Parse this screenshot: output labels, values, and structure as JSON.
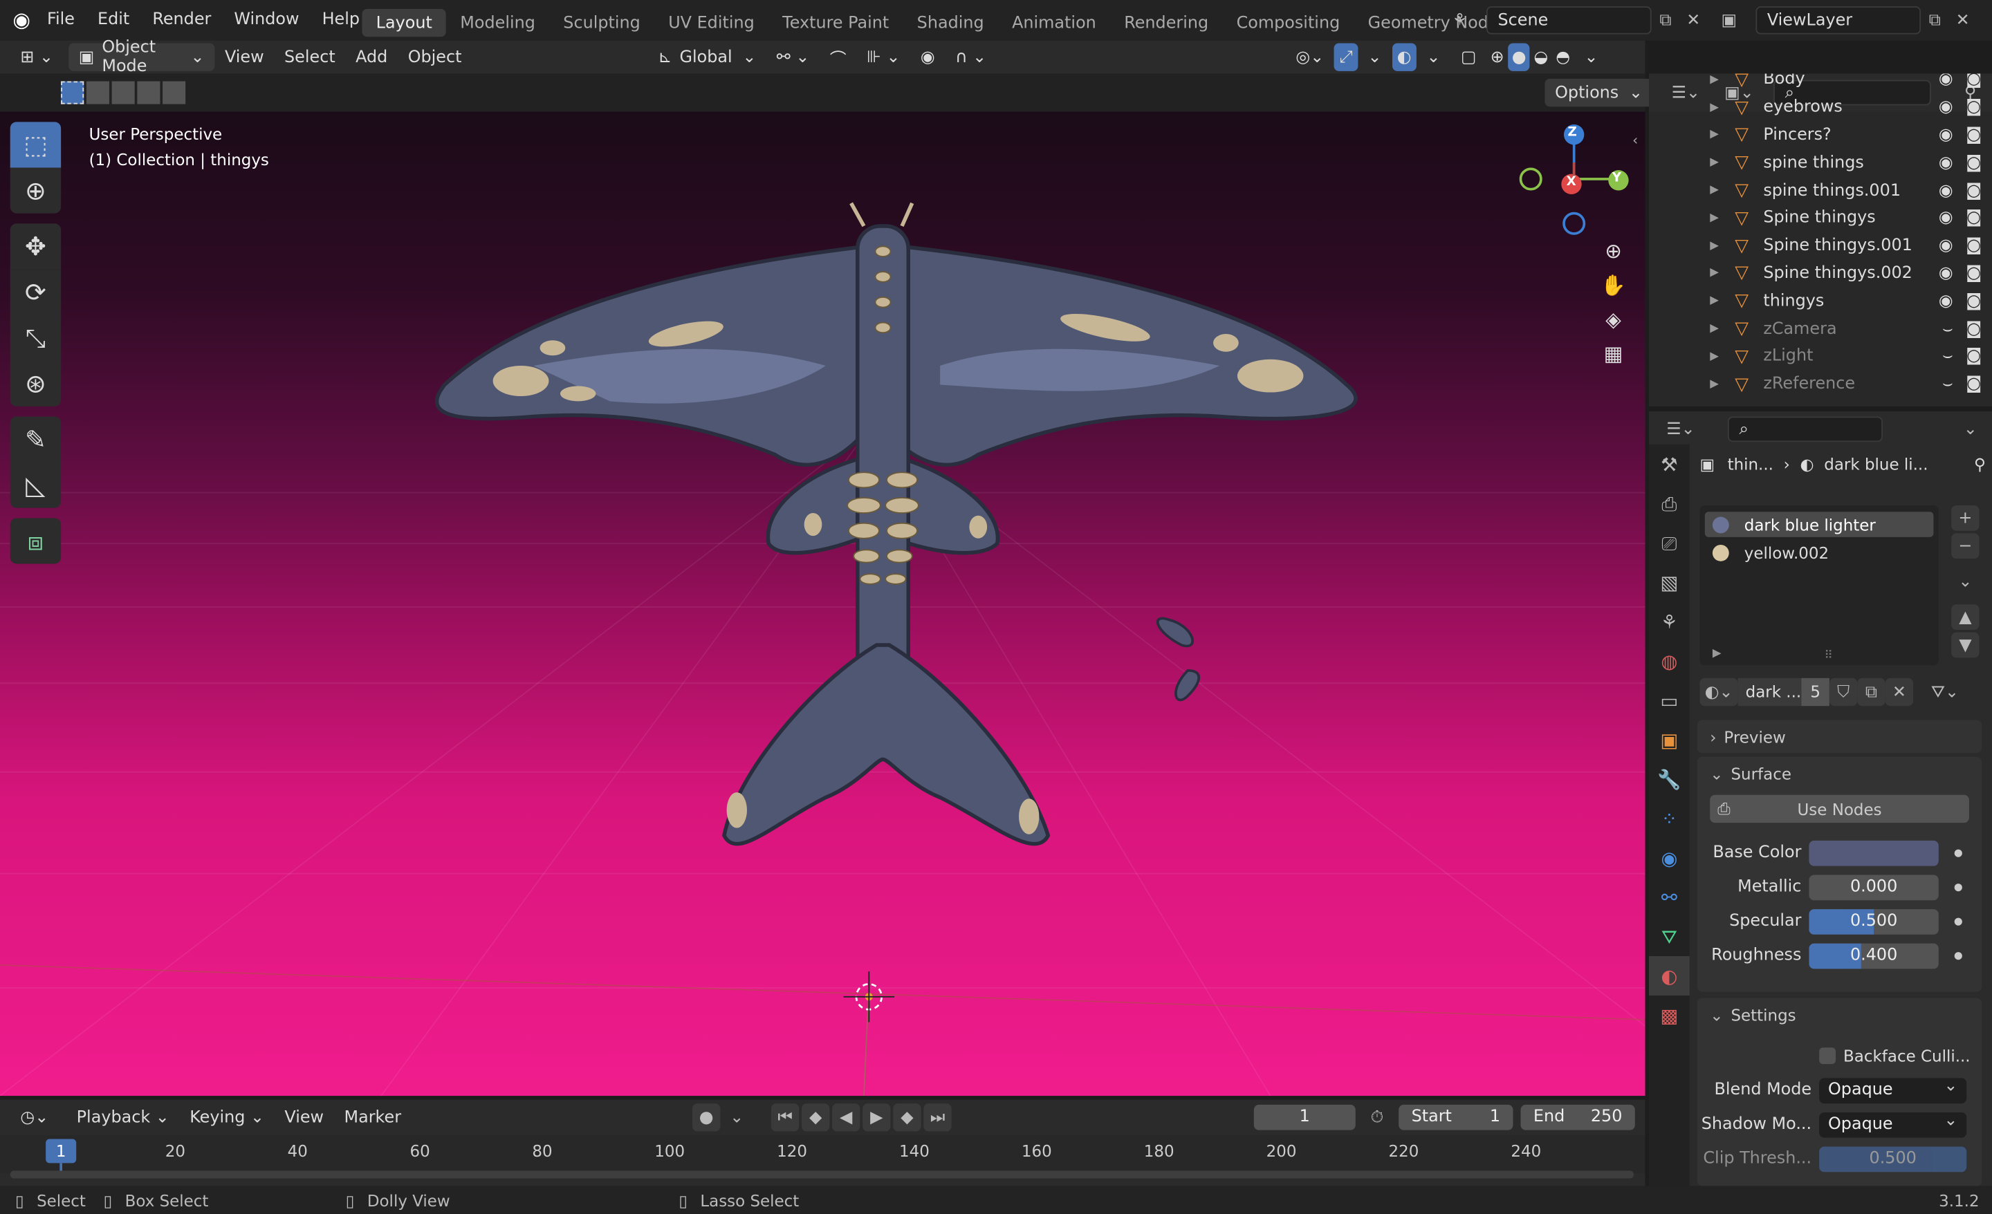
{
  "topbar": {
    "menus": [
      "File",
      "Edit",
      "Render",
      "Window",
      "Help"
    ],
    "workspaces": [
      "Layout",
      "Modeling",
      "Sculpting",
      "UV Editing",
      "Texture Paint",
      "Shading",
      "Animation",
      "Rendering",
      "Compositing",
      "Geometry Nodes"
    ],
    "active_workspace": "Layout",
    "scene": "Scene",
    "view_layer": "ViewLayer"
  },
  "header": {
    "mode": "Object Mode",
    "menus": [
      "View",
      "Select",
      "Add",
      "Object"
    ],
    "orientation": "Global",
    "options": "Options"
  },
  "viewport": {
    "line1": "User Perspective",
    "line2": "(1) Collection | thingys",
    "gizmo": {
      "z": "Z",
      "x": "X",
      "y": "Y"
    }
  },
  "outliner": {
    "items": [
      {
        "name": "Body",
        "dim": false
      },
      {
        "name": "eyebrows",
        "dim": false
      },
      {
        "name": "Pincers?",
        "dim": false
      },
      {
        "name": "spine things",
        "dim": false
      },
      {
        "name": "spine things.001",
        "dim": false
      },
      {
        "name": "Spine thingys",
        "dim": false
      },
      {
        "name": "Spine thingys.001",
        "dim": false
      },
      {
        "name": "Spine thingys.002",
        "dim": false
      },
      {
        "name": "thingys",
        "dim": false
      },
      {
        "name": "zCamera",
        "dim": true
      },
      {
        "name": "zLight",
        "dim": true
      },
      {
        "name": "zReference",
        "dim": true
      }
    ]
  },
  "properties": {
    "breadcrumb_object": "thin...",
    "breadcrumb_material": "dark blue li...",
    "slots": [
      "dark blue lighter",
      "yellow.002"
    ],
    "material_name": "dark ...",
    "users": "5",
    "preview_label": "Preview",
    "surface_label": "Surface",
    "use_nodes": "Use Nodes",
    "base_color_label": "Base Color",
    "base_color": "#565a7a",
    "metallic_label": "Metallic",
    "metallic": "0.000",
    "metallic_frac": 0.0,
    "specular_label": "Specular",
    "specular": "0.500",
    "specular_frac": 0.5,
    "roughness_label": "Roughness",
    "roughness": "0.400",
    "roughness_frac": 0.4,
    "settings_label": "Settings",
    "backface": "Backface Culli...",
    "blend_mode_label": "Blend Mode",
    "blend_mode": "Opaque",
    "shadow_mode_label": "Shadow Mo...",
    "shadow_mode": "Opaque",
    "clip_label": "Clip Thresh...",
    "clip": "0.500"
  },
  "timeline": {
    "menus": [
      "Playback",
      "Keying",
      "View",
      "Marker"
    ],
    "current_frame": "1",
    "start_label": "Start",
    "start": "1",
    "end_label": "End",
    "end": "250",
    "ruler": [
      "20",
      "40",
      "60",
      "80",
      "100",
      "120",
      "140",
      "160",
      "180",
      "200",
      "220",
      "240"
    ],
    "playhead": "1"
  },
  "status": {
    "select": "Select",
    "box_select": "Box Select",
    "dolly": "Dolly View",
    "lasso": "Lasso Select",
    "version": "3.1.2"
  }
}
